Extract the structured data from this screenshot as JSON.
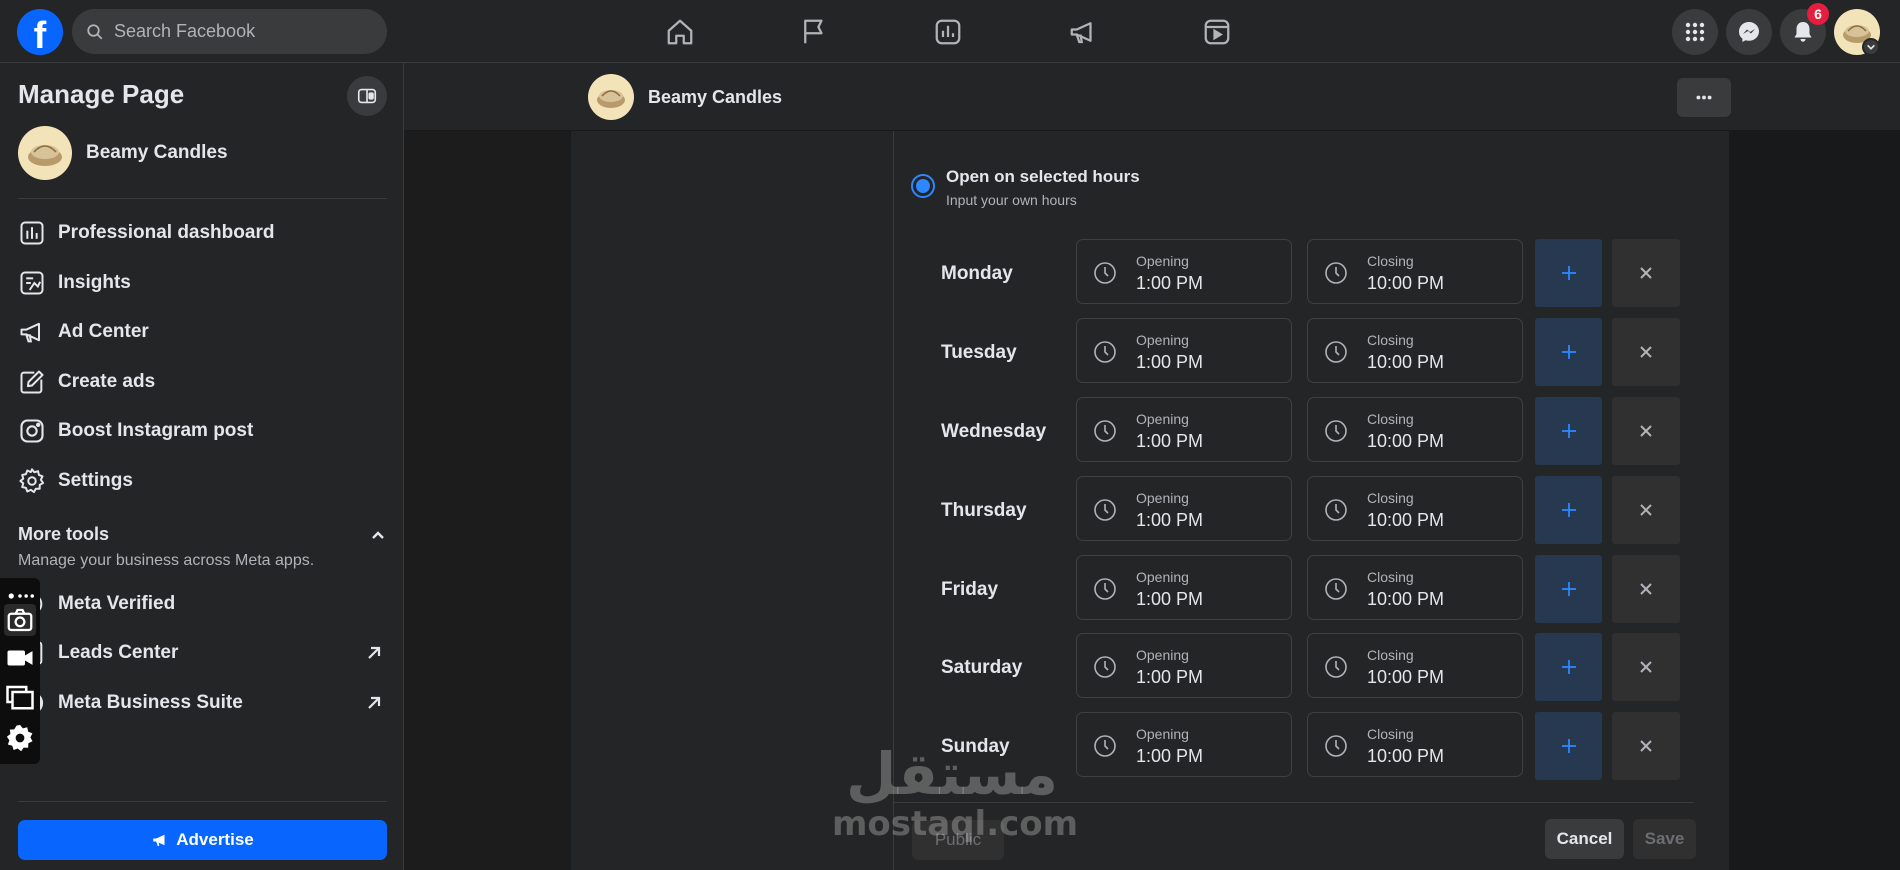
{
  "topbar": {
    "logo_letter": "f",
    "search_placeholder": "Search Facebook",
    "nav_icons": [
      "home-icon",
      "flag-icon",
      "insights-icon",
      "megaphone-icon",
      "reels-icon"
    ],
    "right_icons": [
      "apps-grid-icon",
      "messenger-icon",
      "bell-icon"
    ],
    "notification_count": "6"
  },
  "sidebar": {
    "title": "Manage Page",
    "page_name": "Beamy Candles",
    "items": [
      {
        "label": "Professional dashboard",
        "icon": "dashboard-icon"
      },
      {
        "label": "Insights",
        "icon": "insights-icon"
      },
      {
        "label": "Ad Center",
        "icon": "megaphone-icon"
      },
      {
        "label": "Create ads",
        "icon": "pencil-icon"
      },
      {
        "label": "Boost Instagram post",
        "icon": "instagram-icon"
      },
      {
        "label": "Settings",
        "icon": "gear-icon"
      }
    ],
    "more_tools": {
      "title": "More tools",
      "subtitle": "Manage your business across Meta apps."
    },
    "tools": [
      {
        "label": "Meta Verified"
      },
      {
        "label": "Leads Center"
      },
      {
        "label": "Meta Business Suite"
      }
    ],
    "advertise_label": "Advertise"
  },
  "page_header": {
    "name": "Beamy Candles",
    "more_label": "···"
  },
  "hours": {
    "option_title": "Open on selected hours",
    "option_subtitle": "Input your own hours",
    "opening_caption": "Opening",
    "closing_caption": "Closing",
    "days": [
      {
        "day": "Monday",
        "open": "1:00 PM",
        "close": "10:00 PM"
      },
      {
        "day": "Tuesday",
        "open": "1:00 PM",
        "close": "10:00 PM"
      },
      {
        "day": "Wednesday",
        "open": "1:00 PM",
        "close": "10:00 PM"
      },
      {
        "day": "Thursday",
        "open": "1:00 PM",
        "close": "10:00 PM"
      },
      {
        "day": "Friday",
        "open": "1:00 PM",
        "close": "10:00 PM"
      },
      {
        "day": "Saturday",
        "open": "1:00 PM",
        "close": "10:00 PM"
      },
      {
        "day": "Sunday",
        "open": "1:00 PM",
        "close": "10:00 PM"
      }
    ]
  },
  "footer": {
    "ghost_label": "Public",
    "cancel_label": "Cancel",
    "save_label": "Save"
  },
  "watermark": {
    "arabic": "مستقل",
    "latin": "mostaql.com"
  },
  "colors": {
    "accent": "#0866ff",
    "background": "#18191a",
    "surface": "#242526",
    "add_button": "#263951",
    "badge": "#e41e3f"
  }
}
